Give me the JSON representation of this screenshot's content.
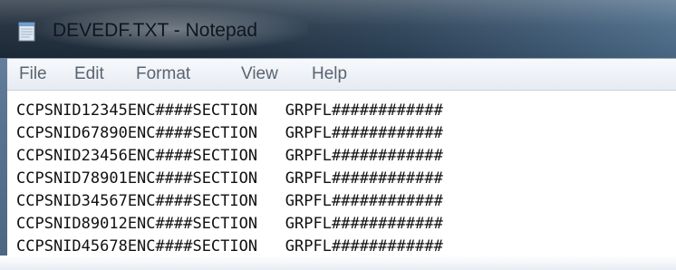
{
  "window": {
    "title": "DEVEDF.TXT - Notepad",
    "accent": "#2b4157"
  },
  "menu": {
    "items": [
      {
        "label": "File"
      },
      {
        "label": "Edit"
      },
      {
        "label": "Format"
      },
      {
        "label": "View"
      },
      {
        "label": "Help"
      }
    ]
  },
  "editor": {
    "lines": [
      "CCPSNID12345ENC####SECTION   GRPFL############",
      "CCPSNID67890ENC####SECTION   GRPFL############",
      "CCPSNID23456ENC####SECTION   GRPFL############",
      "CCPSNID78901ENC####SECTION   GRPFL############",
      "CCPSNID34567ENC####SECTION   GRPFL############",
      "CCPSNID89012ENC####SECTION   GRPFL############",
      "CCPSNID45678ENC####SECTION   GRPFL############"
    ]
  },
  "icons": {
    "app": "notepad-icon"
  }
}
